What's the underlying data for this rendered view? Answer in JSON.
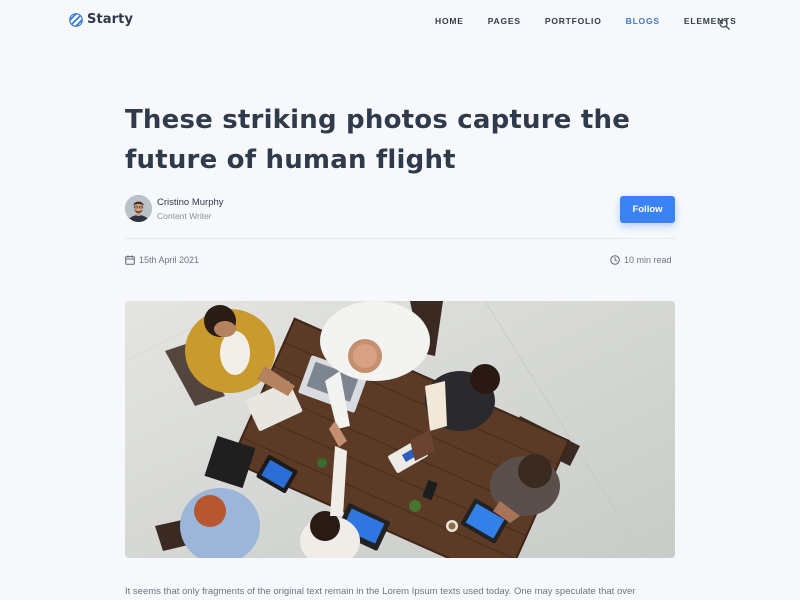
{
  "brand": {
    "name": "Starty",
    "logo_icon": "striped-circle-logo",
    "accent": "#3a7bd5"
  },
  "nav": {
    "items": [
      {
        "label": "HOME",
        "active": false
      },
      {
        "label": "PAGES",
        "active": false
      },
      {
        "label": "PORTFOLIO",
        "active": false
      },
      {
        "label": "BLOGS",
        "active": true
      },
      {
        "label": "ELEMENTS",
        "active": false
      }
    ],
    "search_icon": "search-icon"
  },
  "article": {
    "title_line1": "These striking photos capture the",
    "title_line2": "future of human flight",
    "author": {
      "name": "Cristino Murphy",
      "role": "Content Writer"
    },
    "follow_label": "Follow",
    "date": "15th April 2021",
    "read_time": "10 min read",
    "body_excerpt": "It seems that only fragments of the original text remain in the Lorem Ipsum texts used today. One may speculate that over"
  },
  "colors": {
    "background": "#f6f8fb",
    "primary_button": "#3b82f6",
    "active_nav": "#3a7bd5"
  }
}
